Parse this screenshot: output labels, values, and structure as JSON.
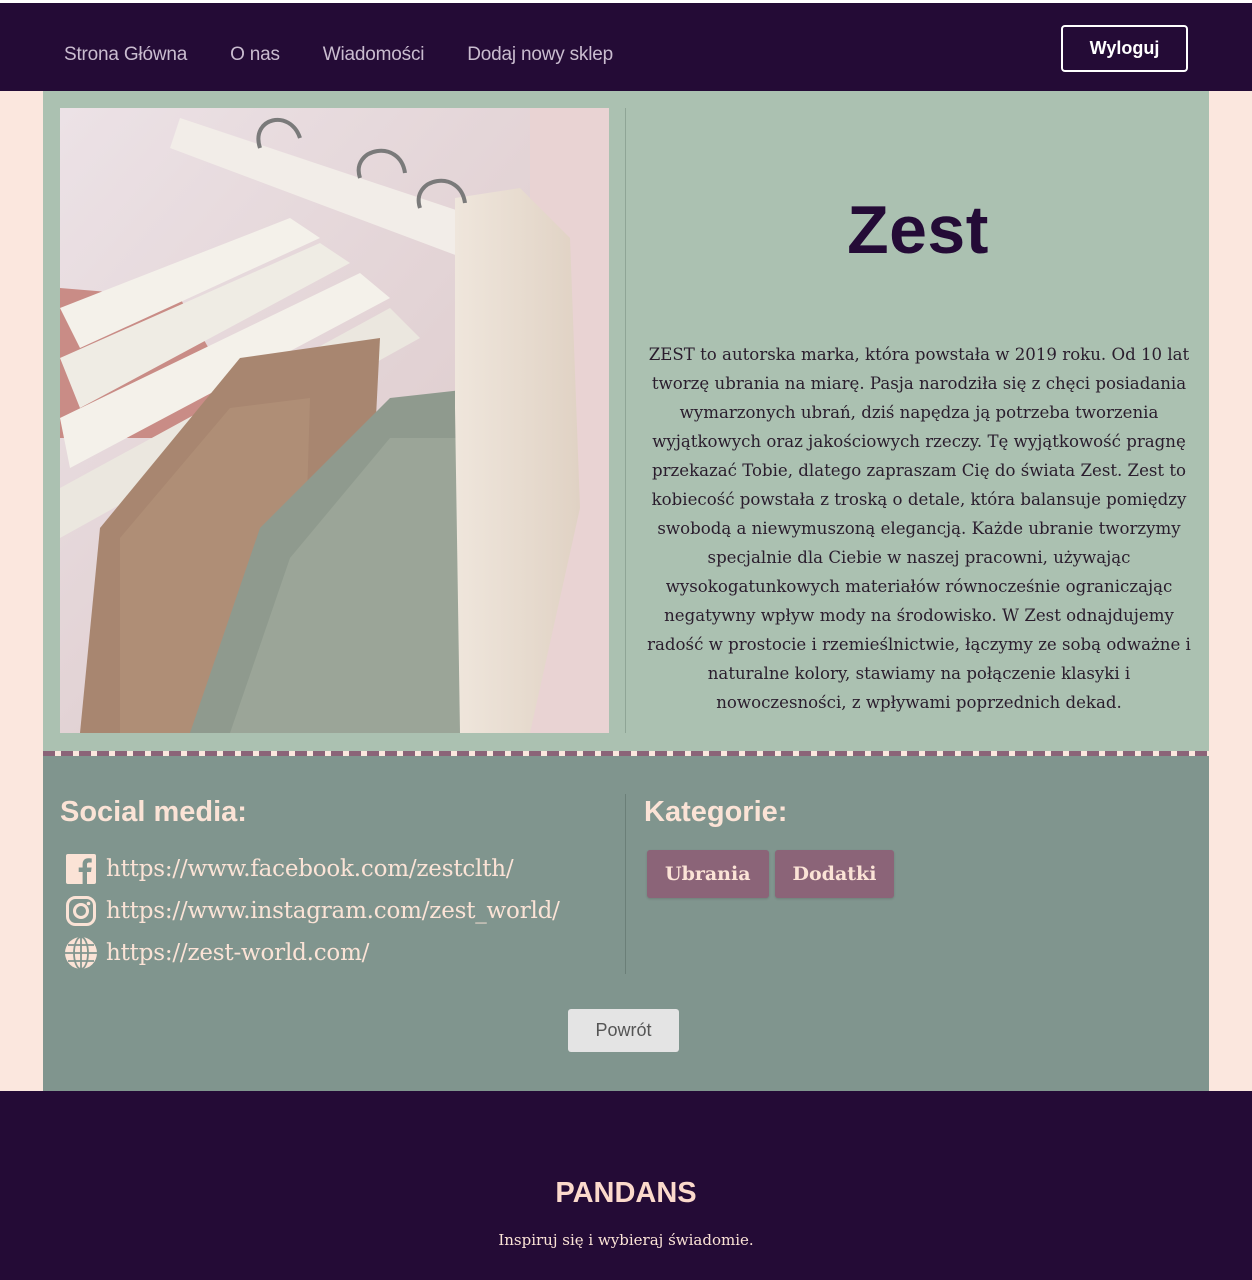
{
  "nav": {
    "items": [
      {
        "label": "Strona Główna"
      },
      {
        "label": "O nas"
      },
      {
        "label": "Wiadomości"
      },
      {
        "label": "Dodaj nowy sklep"
      }
    ],
    "logout_label": "Wyloguj"
  },
  "shop": {
    "image_icon": "clothes-rack-photo",
    "title": "Zest",
    "description": "ZEST to autorska marka, która powstała w 2019 roku. Od 10 lat tworzę ubrania na miarę. Pasja narodziła się z chęci posiadania wymarzonych ubrań, dziś napędza ją potrzeba tworzenia wyjątkowych oraz jakościowych rzeczy. Tę wyjątkowość pragnę przekazać Tobie, dlatego zapraszam Cię do świata Zest. Zest to kobiecość powstała z troską o detale, która balansuje pomiędzy swobodą a niewymuszoną elegancją. Każde ubranie tworzymy specjalnie dla Ciebie w naszej pracowni, używając wysokogatunkowych materiałów równocześnie ograniczając negatywny wpływ mody na środowisko. W Zest odnajdujemy radość w prostocie i rzemieślnictwie, łączymy ze sobą odważne i naturalne kolory, stawiamy na połączenie klasyki i nowoczesności, z wpływami poprzednich dekad."
  },
  "social": {
    "heading": "Social media:",
    "links": [
      {
        "icon": "facebook-icon",
        "url": "https://www.facebook.com/zestclth/"
      },
      {
        "icon": "instagram-icon",
        "url": "https://www.instagram.com/zest_world/"
      },
      {
        "icon": "globe-icon",
        "url": "https://zest-world.com/"
      }
    ]
  },
  "categories": {
    "heading": "Kategorie:",
    "items": [
      "Ubrania",
      "Dodatki"
    ]
  },
  "back_label": "Powrót",
  "footer": {
    "brand": "PANDANS",
    "tagline": "Inspiruj się i wybieraj świadomie."
  },
  "colors": {
    "navbar": "#240b36",
    "panel_top": "#abc1b1",
    "panel_bottom": "#80958e",
    "accent": "#8b6478",
    "page_bg": "#fbe7de",
    "text_light": "#fbe3d6"
  }
}
